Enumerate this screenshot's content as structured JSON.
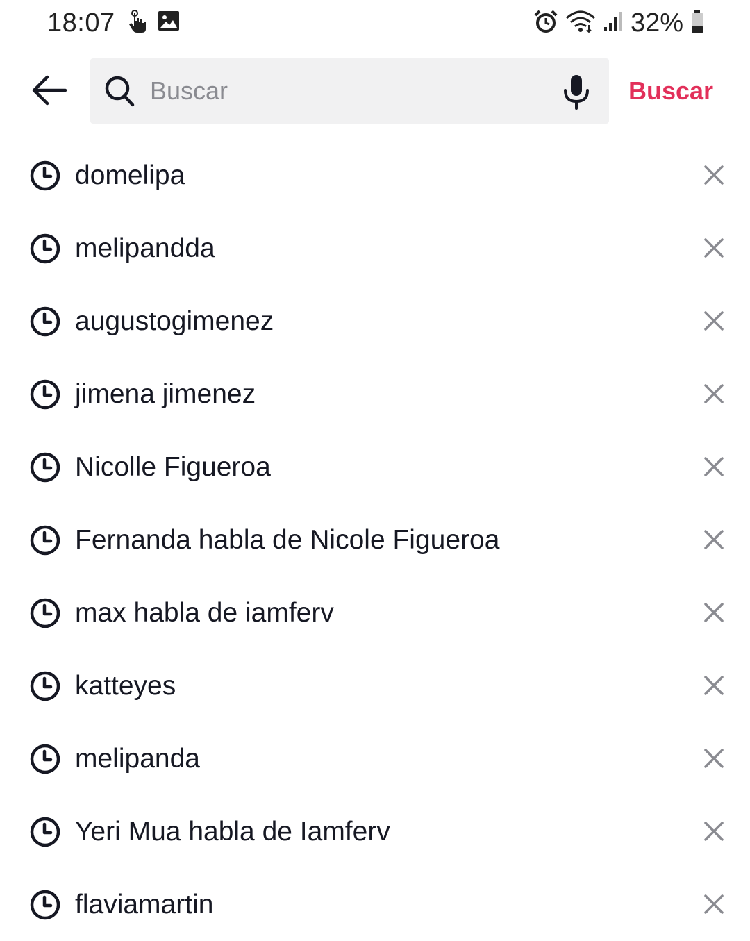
{
  "status_bar": {
    "time": "18:07",
    "battery": "32%",
    "icons": [
      "touch-icon",
      "image-icon",
      "alarm-icon",
      "wifi-icon",
      "signal-icon",
      "battery-icon"
    ]
  },
  "search": {
    "placeholder": "Buscar",
    "value": "",
    "submit_label": "Buscar",
    "accent_color": "#e2305a"
  },
  "history": {
    "items": [
      {
        "label": "domelipa"
      },
      {
        "label": "melipandda"
      },
      {
        "label": "augustogimenez"
      },
      {
        "label": "jimena jimenez"
      },
      {
        "label": "Nicolle Figueroa"
      },
      {
        "label": "Fernanda habla de Nicole Figueroa"
      },
      {
        "label": "max habla de iamferv"
      },
      {
        "label": "katteyes"
      },
      {
        "label": "melipanda"
      },
      {
        "label": "Yeri Mua habla de Iamferv"
      },
      {
        "label": "flaviamartin"
      }
    ]
  }
}
